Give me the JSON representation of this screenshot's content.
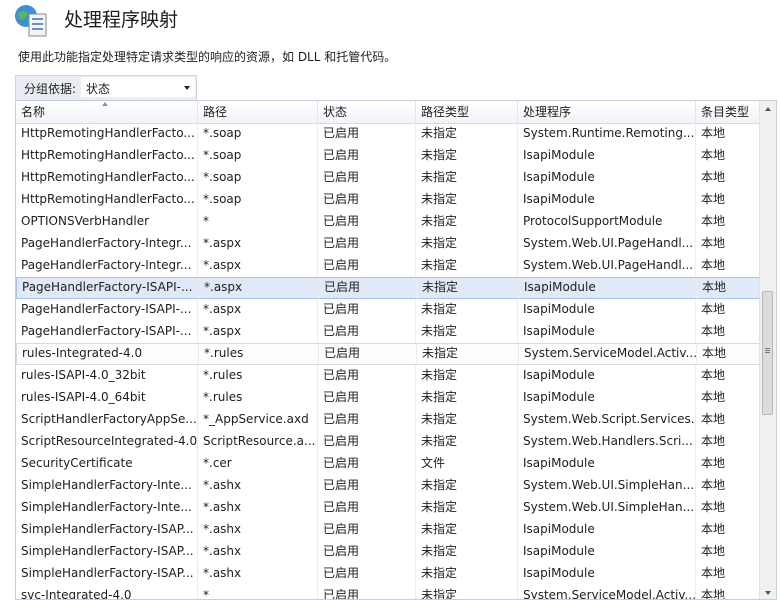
{
  "header": {
    "title": "处理程序映射",
    "description": "使用此功能指定处理特定请求类型的响应的资源，如 DLL 和托管代码。"
  },
  "groupby": {
    "label": "分组依据:",
    "value": "状态"
  },
  "columns": [
    "名称",
    "路径",
    "状态",
    "路径类型",
    "处理程序",
    "条目类型"
  ],
  "rows": [
    [
      "HttpRemotingHandlerFacto...",
      "*.soap",
      "已启用",
      "未指定",
      "System.Runtime.Remoting....",
      "本地"
    ],
    [
      "HttpRemotingHandlerFacto...",
      "*.soap",
      "已启用",
      "未指定",
      "IsapiModule",
      "本地"
    ],
    [
      "HttpRemotingHandlerFacto...",
      "*.soap",
      "已启用",
      "未指定",
      "IsapiModule",
      "本地"
    ],
    [
      "HttpRemotingHandlerFacto...",
      "*.soap",
      "已启用",
      "未指定",
      "IsapiModule",
      "本地"
    ],
    [
      "OPTIONSVerbHandler",
      "*",
      "已启用",
      "未指定",
      "ProtocolSupportModule",
      "本地"
    ],
    [
      "PageHandlerFactory-Integr...",
      "*.aspx",
      "已启用",
      "未指定",
      "System.Web.UI.PageHandl...",
      "本地"
    ],
    [
      "PageHandlerFactory-Integr...",
      "*.aspx",
      "已启用",
      "未指定",
      "System.Web.UI.PageHandl...",
      "本地"
    ],
    [
      "PageHandlerFactory-ISAPI-...",
      "*.aspx",
      "已启用",
      "未指定",
      "IsapiModule",
      "本地"
    ],
    [
      "PageHandlerFactory-ISAPI-...",
      "*.aspx",
      "已启用",
      "未指定",
      "IsapiModule",
      "本地"
    ],
    [
      "PageHandlerFactory-ISAPI-...",
      "*.aspx",
      "已启用",
      "未指定",
      "IsapiModule",
      "本地"
    ],
    [
      "rules-Integrated-4.0",
      "*.rules",
      "已启用",
      "未指定",
      "System.ServiceModel.Activ...",
      "本地"
    ],
    [
      "rules-ISAPI-4.0_32bit",
      "*.rules",
      "已启用",
      "未指定",
      "IsapiModule",
      "本地"
    ],
    [
      "rules-ISAPI-4.0_64bit",
      "*.rules",
      "已启用",
      "未指定",
      "IsapiModule",
      "本地"
    ],
    [
      "ScriptHandlerFactoryAppSe...",
      "*_AppService.axd",
      "已启用",
      "未指定",
      "System.Web.Script.Services...",
      "本地"
    ],
    [
      "ScriptResourceIntegrated-4.0",
      "ScriptResource.a...",
      "已启用",
      "未指定",
      "System.Web.Handlers.Scri...",
      "本地"
    ],
    [
      "SecurityCertificate",
      "*.cer",
      "已启用",
      "文件",
      "IsapiModule",
      "本地"
    ],
    [
      "SimpleHandlerFactory-Inte...",
      "*.ashx",
      "已启用",
      "未指定",
      "System.Web.UI.SimpleHan...",
      "本地"
    ],
    [
      "SimpleHandlerFactory-Inte...",
      "*.ashx",
      "已启用",
      "未指定",
      "System.Web.UI.SimpleHan...",
      "本地"
    ],
    [
      "SimpleHandlerFactory-ISAP...",
      "*.ashx",
      "已启用",
      "未指定",
      "IsapiModule",
      "本地"
    ],
    [
      "SimpleHandlerFactory-ISAP...",
      "*.ashx",
      "已启用",
      "未指定",
      "IsapiModule",
      "本地"
    ],
    [
      "SimpleHandlerFactory-ISAP...",
      "*.ashx",
      "已启用",
      "未指定",
      "IsapiModule",
      "本地"
    ],
    [
      "svc-Integrated-4.0",
      "*",
      "已启用",
      "未指定",
      "System.ServiceModel.Activ...",
      "本地"
    ]
  ],
  "selected_row": 7,
  "highlighted_row": 10
}
